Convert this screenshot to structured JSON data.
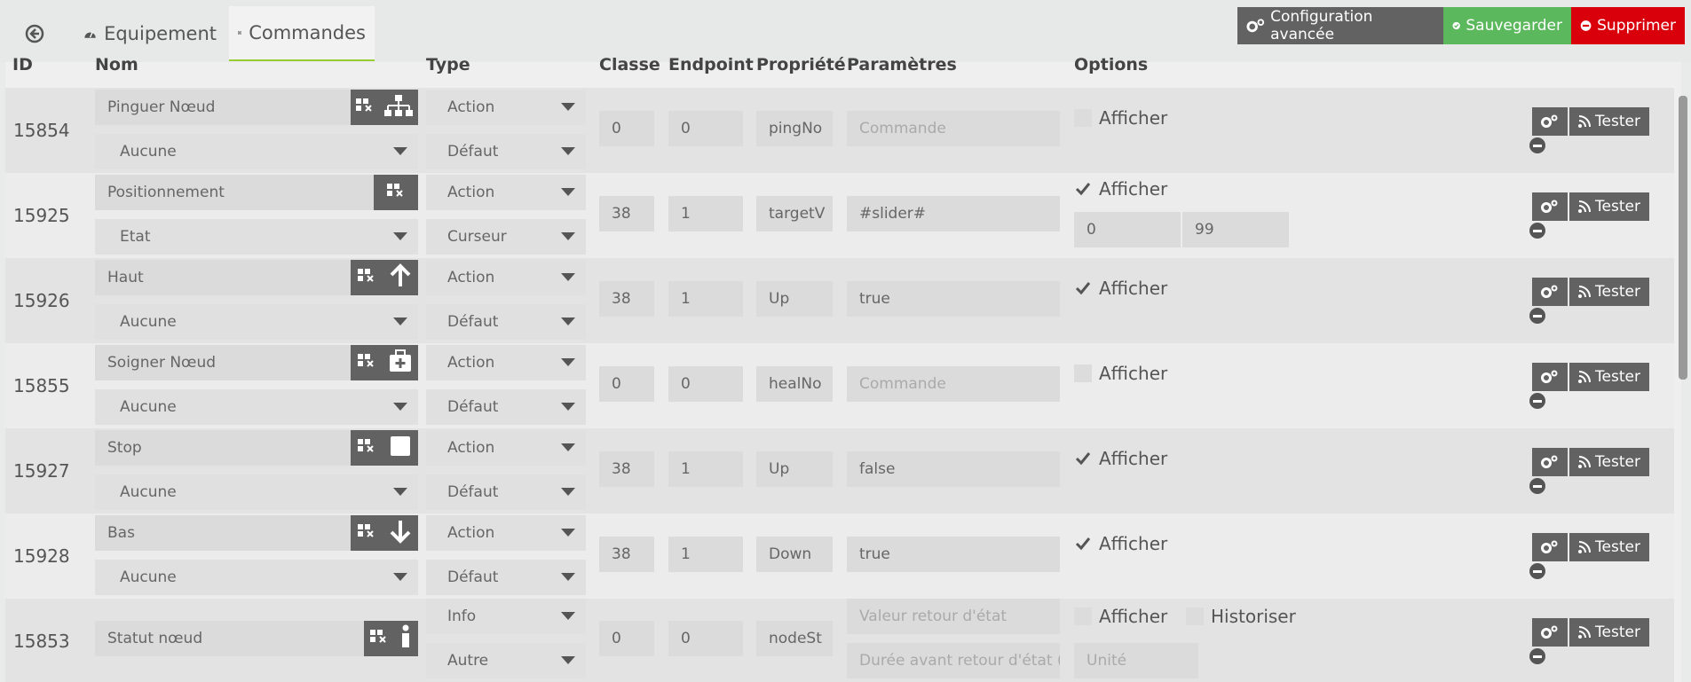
{
  "tabs": {
    "equipement": "Equipement",
    "commandes": "Commandes"
  },
  "toolbar": {
    "advanced": "Configuration avancée",
    "save": "Sauvegarder",
    "delete": "Supprimer"
  },
  "headers": {
    "id": "ID",
    "nom": "Nom",
    "type": "Type",
    "classe": "Classe",
    "endpoint": "Endpoint",
    "propriete": "Propriété",
    "parametres": "Paramètres",
    "options": "Options"
  },
  "labels": {
    "afficher": "Afficher",
    "historiser": "Historiser",
    "tester": "Tester"
  },
  "rows": [
    {
      "id": "15854",
      "name": "Pinguer Nœud",
      "sub": "Aucune",
      "type": "Action",
      "subtype": "Défaut",
      "classe": "0",
      "endpoint": "0",
      "prop": "pingNo",
      "param": "Commande",
      "param_ph": true,
      "afficher": false,
      "icon": "network-icon"
    },
    {
      "id": "15925",
      "name": "Positionnement",
      "sub": "Etat",
      "type": "Action",
      "subtype": "Curseur",
      "classe": "38",
      "endpoint": "1",
      "prop": "targetV",
      "param": "#slider#",
      "param_ph": false,
      "afficher": true,
      "min": "0",
      "max": "99",
      "icon": ""
    },
    {
      "id": "15926",
      "name": "Haut",
      "sub": "Aucune",
      "type": "Action",
      "subtype": "Défaut",
      "classe": "38",
      "endpoint": "1",
      "prop": "Up",
      "param": "true",
      "param_ph": false,
      "afficher": true,
      "icon": "arrow-up-icon"
    },
    {
      "id": "15855",
      "name": "Soigner Nœud",
      "sub": "Aucune",
      "type": "Action",
      "subtype": "Défaut",
      "classe": "0",
      "endpoint": "0",
      "prop": "healNo",
      "param": "Commande",
      "param_ph": true,
      "afficher": false,
      "icon": "medkit-icon"
    },
    {
      "id": "15927",
      "name": "Stop",
      "sub": "Aucune",
      "type": "Action",
      "subtype": "Défaut",
      "classe": "38",
      "endpoint": "1",
      "prop": "Up",
      "param": "false",
      "param_ph": false,
      "afficher": true,
      "icon": "stop-icon"
    },
    {
      "id": "15928",
      "name": "Bas",
      "sub": "Aucune",
      "type": "Action",
      "subtype": "Défaut",
      "classe": "38",
      "endpoint": "1",
      "prop": "Down",
      "param": "true",
      "param_ph": false,
      "afficher": true,
      "icon": "arrow-down-icon"
    }
  ],
  "last_row": {
    "id": "15853",
    "name": "Statut nœud",
    "type": "Info",
    "subtype": "Autre",
    "classe": "0",
    "endpoint": "0",
    "prop": "nodeSt",
    "param1": "Valeur retour d'état",
    "param2": "Durée avant retour d'état (r",
    "unit": "Unité",
    "afficher": false,
    "historiser": false
  }
}
